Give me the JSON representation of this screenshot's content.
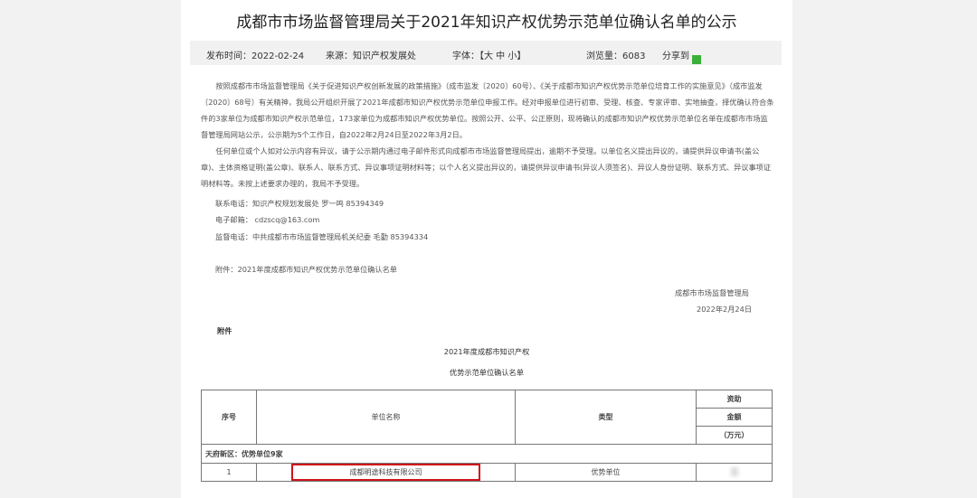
{
  "title": "成都市市场监督管理局关于2021年知识产权优势示范单位确认名单的公示",
  "meta": {
    "publish": "发布时间：2022-02-24",
    "source": "来源：知识产权发展处",
    "font_label": "字体：",
    "font_sizes": "【大 中 小】",
    "views": "浏览量：6083",
    "share": "分享到"
  },
  "body": {
    "p1": "按照成都市市场监督管理局《关于促进知识产权创新发展的政策措施》（成市监发〔2020〕60号）、《关于成都市知识产权优势示范单位培育工作的实施意见》（成市监发〔2020〕68号）有关精神，我局公开组织开展了2021年成都市知识产权优势示范单位申报工作。经对申报单位进行初审、受理、核查、专家评审、实地抽查，择优确认符合条件的3家单位为成都市知识产权示范单位，173家单位为成都市知识产权优势单位。按照公开、公平、公正原则，现将确认的成都市知识产权优势示范单位名单在成都市市场监督管理局网站公示，公示期为5个工作日，自2022年2月24日至2022年3月2日。",
    "p2": "任何单位或个人如对公示内容有异议，请于公示期内通过电子邮件形式向成都市市场监督管理局提出，逾期不予受理。以单位名义提出异议的，请提供异议申请书(盖公章)、主体资格证明(盖公章)、联系人、联系方式、异议事项证明材料等；以个人名义提出异议的，请提供异议申请书(异议人须签名)、异议人身份证明、联系方式、异议事项证明材料等。未按上述要求办理的，我局不予受理。",
    "contact": "联系电话：知识产权规划发展处 罗一鸣  85394349",
    "email": "电子邮箱：  cdzscq@163.com",
    "supervise": "监督电话：中共成都市市场监督管理局机关纪委 毛勤   85394334",
    "attachment": "附件：2021年度成都市知识产权优势示范单位确认名单",
    "signer": "成都市市场监督管理局",
    "date": "2022年2月24日"
  },
  "annex": {
    "label": "附件",
    "title1": "2021年度成都市知识产权",
    "title2": "优势示范单位确认名单"
  },
  "table": {
    "headers": {
      "no": "序号",
      "name": "单位名称",
      "type": "类型",
      "fund1": "资助",
      "fund2": "金额",
      "fund3": "（万元）"
    },
    "section": "天府新区：优势单位9家",
    "rows": [
      {
        "no": "1",
        "name": "成都明途科技有限公司",
        "type": "优势单位"
      }
    ]
  },
  "colors": {
    "highlight": "#d0121b"
  }
}
